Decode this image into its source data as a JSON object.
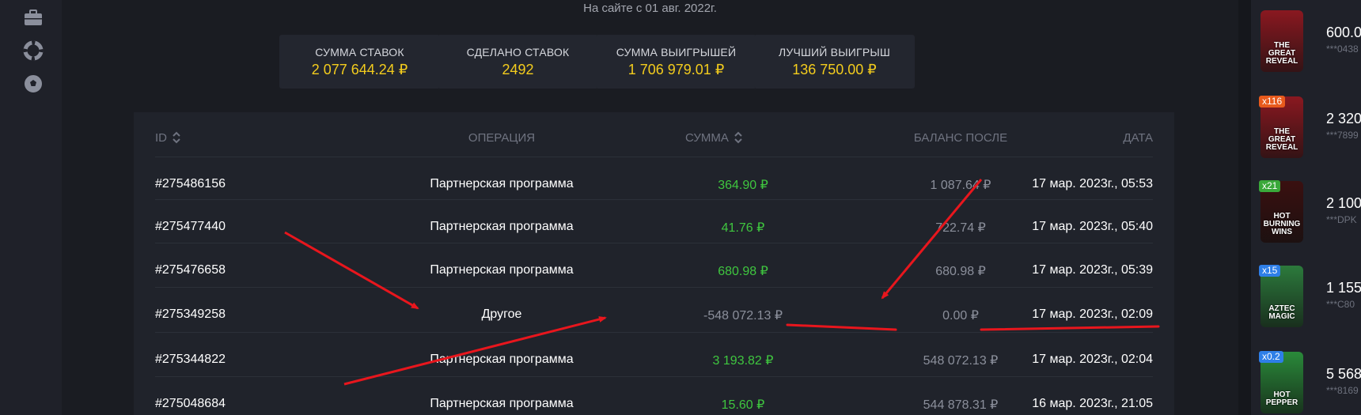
{
  "sidebar": {
    "icons": [
      "briefcase-icon",
      "lifebuoy-icon",
      "soccer-ball-icon"
    ]
  },
  "profile": {
    "since": "На сайте с 01 авг. 2022г."
  },
  "stats": [
    {
      "label": "СУММА СТАВОК",
      "value": "2 077 644.24 ₽"
    },
    {
      "label": "СДЕЛАНО СТАВОК",
      "value": "2492"
    },
    {
      "label": "СУММА ВЫИГРЫШЕЙ",
      "value": "1 706 979.01 ₽"
    },
    {
      "label": "ЛУЧШИЙ ВЫИГРЫШ",
      "value": "136 750.00 ₽"
    }
  ],
  "table": {
    "headers": {
      "id": "ID",
      "operation": "ОПЕРАЦИЯ",
      "sum": "СУММА",
      "balance": "БАЛАНС ПОСЛЕ",
      "date": "ДАТА"
    },
    "rows": [
      {
        "id": "#275486156",
        "operation": "Партнерская программа",
        "sum": "364.90 ₽",
        "balance": "1 087.64 ₽",
        "date": "17 мар. 2023г., 05:53"
      },
      {
        "id": "#275477440",
        "operation": "Партнерская программа",
        "sum": "41.76 ₽",
        "balance": "722.74 ₽",
        "date": "17 мар. 2023г., 05:40"
      },
      {
        "id": "#275476658",
        "operation": "Партнерская программа",
        "sum": "680.98 ₽",
        "balance": "680.98 ₽",
        "date": "17 мар. 2023г., 05:39"
      },
      {
        "id": "#275349258",
        "operation": "Другое",
        "sum": "-548 072.13 ₽",
        "balance": "0.00 ₽",
        "date": "17 мар. 2023г., 02:09"
      },
      {
        "id": "#275344822",
        "operation": "Партнерская программа",
        "sum": "3 193.82 ₽",
        "balance": "548 072.13 ₽",
        "date": "17 мар. 2023г., 02:04"
      },
      {
        "id": "#275048684",
        "operation": "Партнерская программа",
        "sum": "15.60 ₽",
        "balance": "544 878.31 ₽",
        "date": "16 мар. 2023г., 21:05"
      }
    ]
  },
  "colors": {
    "accent_yellow": "#f3cc1d",
    "positive_green": "#3fc63f",
    "annotation_red": "#e8161d"
  },
  "wins": [
    {
      "game_lines": [
        "THE GREAT",
        "REVEAL"
      ],
      "multiplier": "",
      "amount": "600.0",
      "user": "***0438",
      "card_color": "#8a1820"
    },
    {
      "game_lines": [
        "THE GREAT",
        "REVEAL"
      ],
      "multiplier": "x116",
      "amount": "2 320",
      "user": "***7899",
      "card_color": "#8a1820",
      "mult_color": "#e85a1c"
    },
    {
      "game_lines": [
        "HOT",
        "BURNING",
        "WINS"
      ],
      "multiplier": "x21",
      "amount": "2 100",
      "user": "***DPK",
      "card_color": "#3a1010",
      "mult_color": "#3aa83a"
    },
    {
      "game_lines": [
        "AZTEC",
        "MAGIC"
      ],
      "multiplier": "x15",
      "amount": "1 155",
      "user": "***C80",
      "card_color": "#2c7a3c",
      "mult_color": "#2e7fe8"
    },
    {
      "game_lines": [
        "HOT",
        "PEPPER"
      ],
      "multiplier": "x0.2",
      "amount": "5 568",
      "user": "***8169",
      "card_color": "#2a8a3a",
      "mult_color": "#2e7fe8"
    }
  ]
}
